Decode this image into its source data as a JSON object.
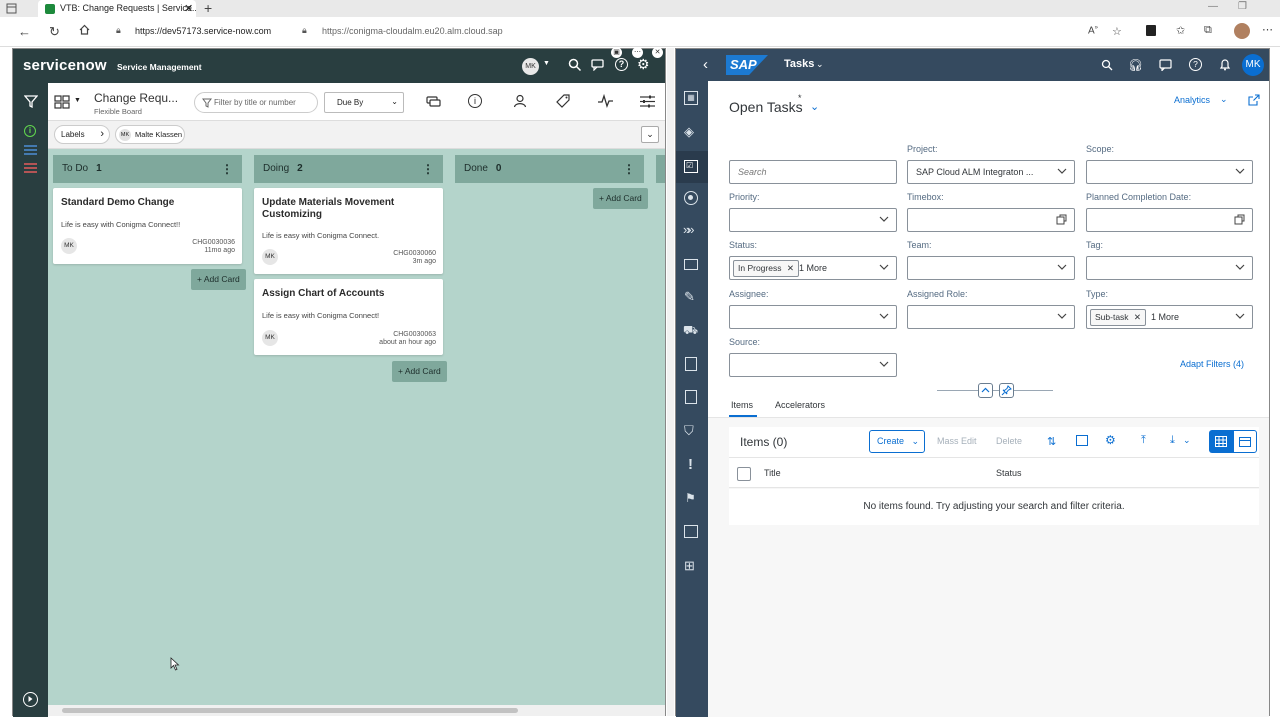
{
  "browser": {
    "tab_title": "VTB: Change Requests | Service...",
    "url_left": "https://dev57173.service-now.com",
    "url_right": "https://conigma-cloudalm.eu20.alm.cloud.sap"
  },
  "servicenow": {
    "logo": "servicenow",
    "product": "Service Management",
    "user_initials": "MK",
    "board_title": "Change Requ...",
    "board_subtitle": "Flexible Board",
    "filter_placeholder": "Filter by title or number",
    "sort_select": "Due By",
    "labels_chip": "Labels",
    "user_chip": "Malte Klassen",
    "user_chip_initials": "MK",
    "lanes": [
      {
        "name": "To Do",
        "count": "1"
      },
      {
        "name": "Doing",
        "count": "2"
      },
      {
        "name": "Done",
        "count": "0"
      }
    ],
    "cards": [
      {
        "title": "Standard Demo Change",
        "desc": "Life is easy with Conigma Connect!!",
        "number": "CHG0030036",
        "time": "11mo ago",
        "initials": "MK"
      },
      {
        "title": "Update Materials Movement Customizing",
        "desc": "Life is easy with Conigma Connect.",
        "number": "CHG0030060",
        "time": "3m ago",
        "initials": "MK"
      },
      {
        "title": "Assign Chart of Accounts",
        "desc": "Life is easy with Conigma Connect!",
        "number": "CHG0030063",
        "time": "about an hour ago",
        "initials": "MK"
      }
    ],
    "add_card_label": "Add Card"
  },
  "sap": {
    "logo": "SAP",
    "app_title": "Tasks",
    "user_initials": "MK",
    "view_title": "Open Tasks",
    "view_modified_marker": "*",
    "analytics": "Analytics",
    "search_placeholder": "Search",
    "filters": {
      "project_label": "Project:",
      "project_value": "SAP Cloud ALM Integraton ...",
      "scope_label": "Scope:",
      "priority_label": "Priority:",
      "timebox_label": "Timebox:",
      "planned_label": "Planned Completion Date:",
      "status_label": "Status:",
      "status_token": "In Progress",
      "status_more": "1 More",
      "team_label": "Team:",
      "tag_label": "Tag:",
      "assignee_label": "Assignee:",
      "role_label": "Assigned Role:",
      "type_label": "Type:",
      "type_token": "Sub-task",
      "type_more": "1 More",
      "source_label": "Source:",
      "adapt_filters": "Adapt Filters (4)"
    },
    "tabs": [
      "Items",
      "Accelerators"
    ],
    "table": {
      "title": "Items (0)",
      "create": "Create",
      "mass_edit": "Mass Edit",
      "delete": "Delete",
      "col_title": "Title",
      "col_status": "Status",
      "empty": "No items found. Try adjusting your search and filter criteria."
    }
  },
  "colors": {
    "sn_dark": "#293e40",
    "sn_board": "#b4d4cb",
    "sn_lane": "#7fa89c",
    "sap_shell": "#354a5f",
    "sap_link": "#0a6ed1"
  }
}
